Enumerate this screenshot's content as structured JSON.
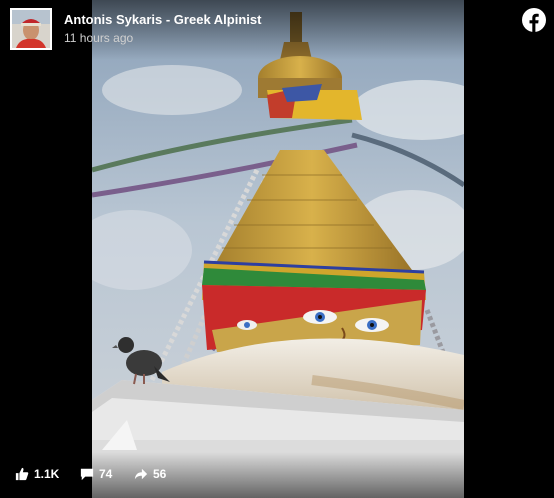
{
  "post": {
    "page_name": "Antonis Sykaris - Greek Alpinist",
    "timestamp": "11 hours ago"
  },
  "icons": {
    "brand": "facebook-icon",
    "like": "thumbs-up-icon",
    "comment": "comment-icon",
    "share": "share-arrow-icon"
  },
  "stats": {
    "likes": "1.1K",
    "comments": "74",
    "shares": "56"
  },
  "colors": {
    "background": "#000000",
    "text": "#ffffff",
    "subtext": "#d0d0d0"
  }
}
